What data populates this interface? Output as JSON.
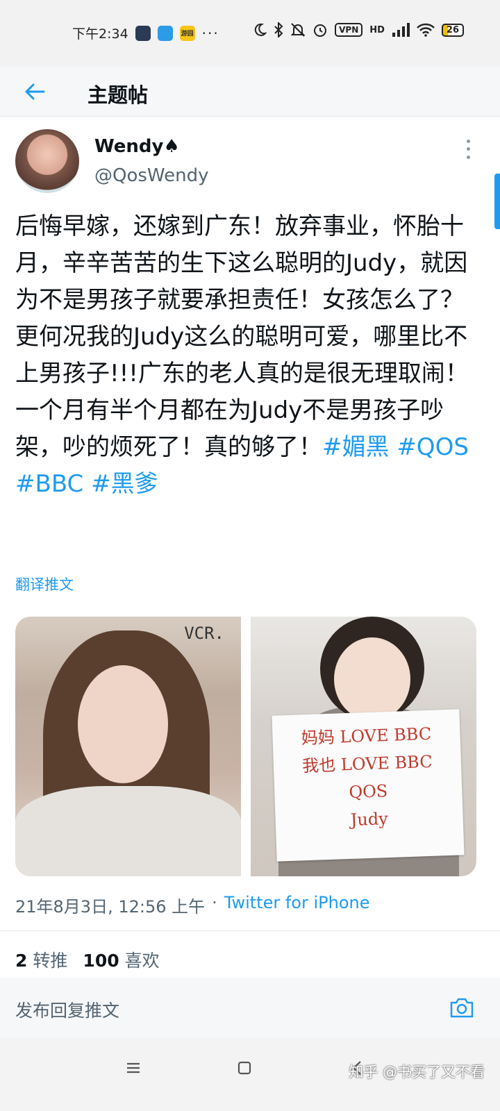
{
  "status_bar": {
    "time": "下午2:34",
    "app_icon_text": "游园",
    "dots": "···",
    "vpn": "VPN",
    "signal": "HD",
    "battery": "26"
  },
  "header": {
    "title": "主题帖"
  },
  "tweet": {
    "author_name": "Wendy♠",
    "author_handle": "@QosWendy",
    "body_text": "后悔早嫁，还嫁到广东！放弃事业，怀胎十月，辛辛苦苦的生下这么聪明的Judy，就因为不是男孩子就要承担责任！女孩怎么了？更何况我的Judy这么的聪明可爱，哪里比不上男孩子!!!广东的老人真的是很无理取闹！一个月有半个月都在为Judy不是男孩子吵架，吵的烦死了！真的够了！",
    "hashtags": [
      "#媚黑",
      "#QOS",
      "#BBC",
      "#黑爹"
    ],
    "translate_label": "翻译推文",
    "photo_left_label": "VCR.",
    "sign_lines": [
      "妈妈 LOVE BBC",
      "我也 LOVE BBC",
      "QOS",
      "Judy"
    ],
    "timestamp": "21年8月3日, 12:56 上午",
    "separator": "·",
    "source": "Twitter for iPhone",
    "retweets_count": "2",
    "retweets_label": "转推",
    "likes_count": "100",
    "likes_label": "喜欢"
  },
  "reply": {
    "placeholder": "发布回复推文"
  },
  "watermark": "知乎 @书买了又不看",
  "colors": {
    "accent": "#1d9bf0",
    "text_primary": "#0f1419",
    "text_secondary": "#536471"
  }
}
